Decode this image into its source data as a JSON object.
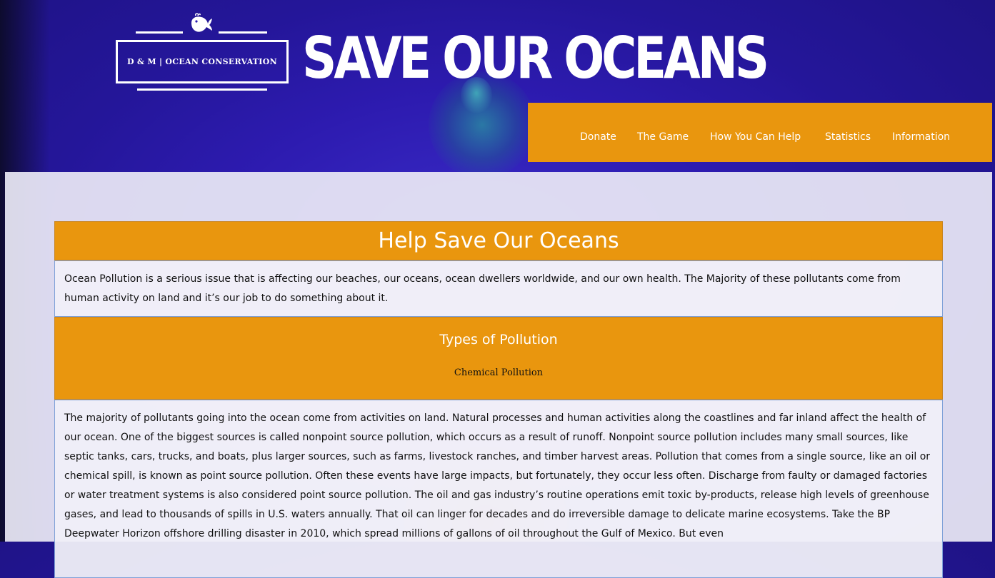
{
  "brand": {
    "logo_text": "D & M | OCEAN CONSERVATION",
    "site_title": "SAVE OUR OCEANS",
    "logo_icon": "whale-icon"
  },
  "nav": {
    "items": [
      "Donate",
      "The Game",
      "How You Can Help",
      "Statistics",
      "Information"
    ]
  },
  "main": {
    "heading": "Help Save Our Oceans",
    "intro": "Ocean Pollution is a serious issue that is affecting our beaches, our oceans, ocean dwellers worldwide, and our own health. The Majority of these pollutants come from human activity on land and it’s our job to do something about it.",
    "types_heading": "Types of Pollution",
    "subsection_title": "Chemical Pollution",
    "body": "The majority of pollutants going into the ocean come from activities on land. Natural processes and human activities along the coastlines and far inland affect the health of our ocean. One of the biggest sources is called nonpoint source pollution, which occurs as a result of runoff. Nonpoint source pollution includes many small sources, like septic tanks, cars, trucks, and boats, plus larger sources, such as farms, livestock ranches, and timber harvest areas. Pollution that comes from a single source, like an oil or chemical spill, is known as point source pollution. Often these events have large impacts, but fortunately, they occur less often. Discharge from faulty or damaged factories or water treatment systems is also considered point source pollution. The oil and gas industry’s routine operations emit toxic by-products, release high levels of greenhouse gases, and lead to thousands of spills in U.S. waters annually. That oil can linger for decades and do irreversible damage to delicate marine ecosystems. Take the BP Deepwater Horizon offshore drilling disaster in 2010, which spread millions of gallons of oil throughout the Gulf of Mexico. But even"
  },
  "colors": {
    "accent_orange": "#e9960e",
    "background_blue": "#2d1bb0",
    "panel": "#ecebf6",
    "box_border": "#7fa1d8"
  }
}
